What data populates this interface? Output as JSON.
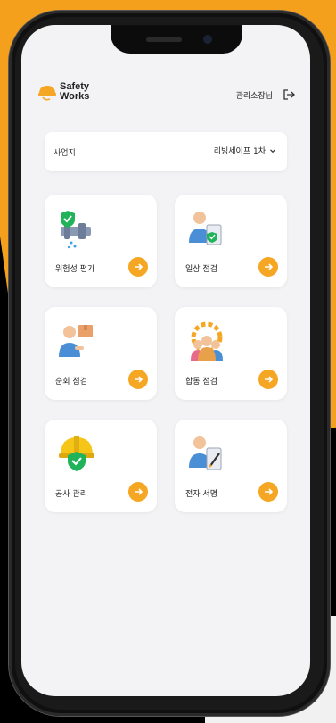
{
  "app": {
    "logo_line1": "Safety",
    "logo_line2": "Works",
    "user_name": "관리소장님"
  },
  "site": {
    "label": "사업지",
    "selected": "리빙세이프 1차"
  },
  "tiles": [
    {
      "label": "위험성 평가",
      "icon": "risk-assessment-icon"
    },
    {
      "label": "일상 점검",
      "icon": "daily-inspection-icon"
    },
    {
      "label": "순회 점검",
      "icon": "patrol-inspection-icon"
    },
    {
      "label": "합동 점검",
      "icon": "joint-inspection-icon"
    },
    {
      "label": "공사 관리",
      "icon": "construction-management-icon"
    },
    {
      "label": "전자 서명",
      "icon": "e-signature-icon"
    }
  ],
  "colors": {
    "accent": "#f5a623",
    "background": "#f3f3f5",
    "shield_green": "#21b35a"
  }
}
